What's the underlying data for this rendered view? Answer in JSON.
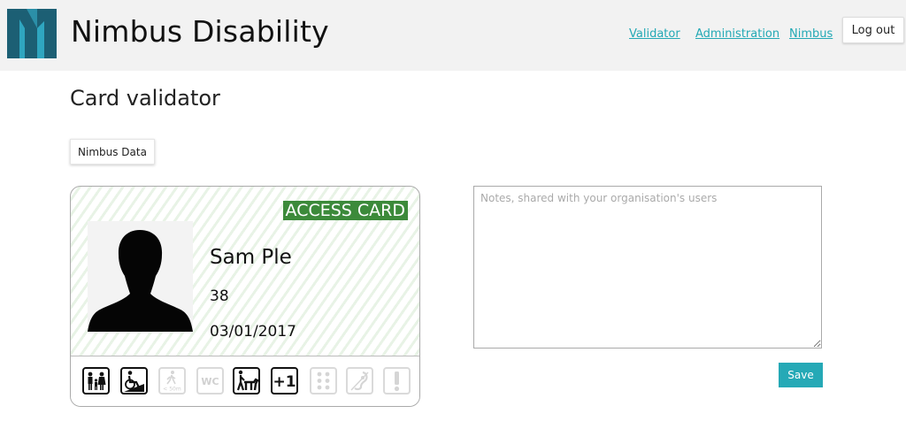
{
  "header": {
    "brand": "Nimbus Disability",
    "nav": [
      {
        "label": "Validator"
      },
      {
        "label": "Administration"
      },
      {
        "label": "Nimbus"
      }
    ],
    "logout_label": "Log out"
  },
  "main": {
    "title": "Card validator",
    "nimbus_data_label": "Nimbus Data"
  },
  "card": {
    "badge": "ACCESS CARD",
    "name": "Sam Ple",
    "id": "38",
    "date": "03/01/2017",
    "icons": [
      {
        "name": "family-icon",
        "active": true
      },
      {
        "name": "wheelchair-icon",
        "active": true
      },
      {
        "name": "walk-50m-icon",
        "active": false,
        "text": "< 50m"
      },
      {
        "name": "wc-icon",
        "active": false,
        "text": "WC"
      },
      {
        "name": "guide-dog-icon",
        "active": true
      },
      {
        "name": "plus-one-icon",
        "active": true,
        "text": "+1"
      },
      {
        "name": "braille-icon",
        "active": false
      },
      {
        "name": "hearing-icon",
        "active": false
      },
      {
        "name": "exclamation-icon",
        "active": false
      }
    ]
  },
  "notes": {
    "placeholder": "Notes, shared with your organisation's users",
    "value": ""
  },
  "save_label": "Save",
  "colors": {
    "brand_teal": "#25a9b6",
    "logo_dark": "#1c5f74",
    "card_green": "#3c8a3a"
  }
}
